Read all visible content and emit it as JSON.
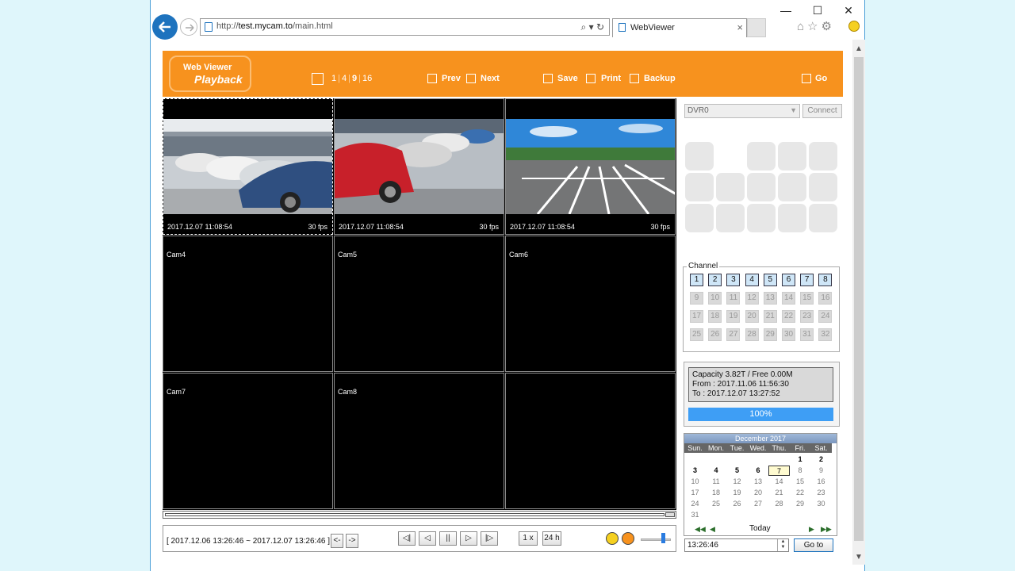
{
  "browser": {
    "url_prefix": "http://",
    "url_host": "test.mycam.to",
    "url_path": "/main.html",
    "addr_tools": "⌕ ▾ ↻",
    "tab_title": "WebViewer",
    "tab_close": "×",
    "minimize": "—",
    "maximize": "☐",
    "close": "✕",
    "toolbar_icons": "⌂☆⚙"
  },
  "header": {
    "logo_line1": "Web Viewer",
    "logo_line2": "Playback",
    "split_1": "1",
    "split_4": "4",
    "split_9": "9",
    "split_16": "16",
    "split_sep": "|",
    "prev": "Prev",
    "next": "Next",
    "save": "Save",
    "print": "Print",
    "backup": "Backup",
    "go": "Go"
  },
  "cameras": [
    {
      "label": "",
      "timestamp": "2017.12.07 11:08:54",
      "fps": "30 fps"
    },
    {
      "label": "",
      "timestamp": "2017.12.07 11:08:54",
      "fps": "30 fps"
    },
    {
      "label": "",
      "timestamp": "2017.12.07 11:08:54",
      "fps": "30 fps"
    },
    {
      "label": "Cam4"
    },
    {
      "label": "Cam5"
    },
    {
      "label": "Cam6"
    },
    {
      "label": "Cam7"
    },
    {
      "label": "Cam8"
    },
    {
      "label": ""
    }
  ],
  "playback": {
    "range": "[ 2017.12.06 13:26:46 ~ 2017.12.07 13:26:46 ]",
    "step_back": "<-",
    "step_fwd": "->",
    "to_start": "◁|",
    "rewind": "◁",
    "pause": "||",
    "play": "▷",
    "to_end": "|▷",
    "speed": "1 x",
    "span": "24 h"
  },
  "right": {
    "dvr": "DVR0",
    "connect": "Connect",
    "channel_title": "Channel",
    "channels": [
      "1",
      "2",
      "3",
      "4",
      "5",
      "6",
      "7",
      "8",
      "9",
      "10",
      "11",
      "12",
      "13",
      "14",
      "15",
      "16",
      "17",
      "18",
      "19",
      "20",
      "21",
      "22",
      "23",
      "24",
      "25",
      "26",
      "27",
      "28",
      "29",
      "30",
      "31",
      "32"
    ],
    "capacity": "Capacity 3.82T / Free 0.00M",
    "from": "From  : 2017.11.06 11:56:30",
    "to": "To   : 2017.12.07 13:27:52",
    "progress": "100%",
    "progress_value": 1.0
  },
  "calendar": {
    "title": "December 2017",
    "dow": [
      "Sun.",
      "Mon.",
      "Tue.",
      "Wed.",
      "Thu.",
      "Fri.",
      "Sat."
    ],
    "today_label": "Today",
    "nav_prev_year": "◀◀",
    "nav_prev": "◀",
    "nav_next": "▶",
    "nav_next_year": "▶▶",
    "days": [
      "1",
      "2",
      "3",
      "4",
      "5",
      "6",
      "7",
      "8",
      "9",
      "10",
      "11",
      "12",
      "13",
      "14",
      "15",
      "16",
      "17",
      "18",
      "19",
      "20",
      "21",
      "22",
      "23",
      "24",
      "25",
      "26",
      "27",
      "28",
      "29",
      "30",
      "31"
    ],
    "time": "13:26:46",
    "goto": "Go to",
    "spin_up": "▲",
    "spin_down": "▼"
  }
}
